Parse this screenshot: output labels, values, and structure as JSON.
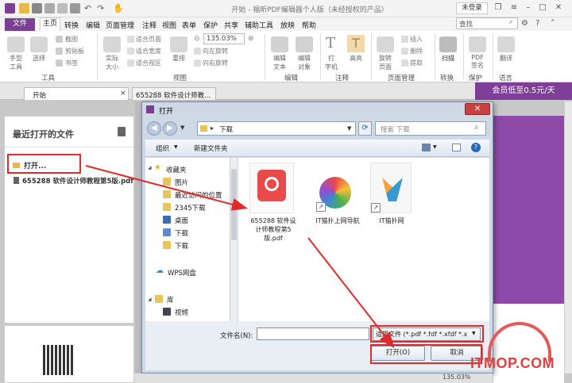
{
  "titlebar": {
    "title": "开始 - 福昕PDF编辑器个人版（未经授权的产品）",
    "login": "未登录"
  },
  "menubar": {
    "file": "文件",
    "items": [
      "主页",
      "转换",
      "编辑",
      "页面管理",
      "注释",
      "视图",
      "表单",
      "保护",
      "共享",
      "辅助工具",
      "放映",
      "帮助"
    ],
    "search_placeholder": "查找"
  },
  "ribbon": {
    "tools": {
      "hand": "手型\n工具",
      "select": "选择",
      "screenshot": "截图",
      "clipboard": "剪贴板",
      "bookmark": "书签",
      "group": "工具"
    },
    "view": {
      "actual": "实际\n大小",
      "fit_page": "适合页面",
      "fit_width": "适合宽度",
      "fit_view": "适合视区",
      "reflow": "重排",
      "zoom": "135.03%",
      "rotate_left": "向左旋转",
      "rotate_right": "向右旋转",
      "group": "视图"
    },
    "edit": {
      "edit_text": "编辑\n文本",
      "edit_object": "编辑\n对象",
      "group": "编辑"
    },
    "comment": {
      "typewriter": "打\n字机",
      "highlight": "高亮",
      "group": "注释"
    },
    "page": {
      "rotate": "旋转\n页面",
      "insert": "插入",
      "delete": "删除",
      "extract": "提取",
      "group": "页面管理"
    },
    "convert": {
      "scan": "扫描",
      "group": "转换"
    },
    "protect": {
      "sign": "PDF\n签名",
      "group": "保护"
    },
    "lang": {
      "translate": "翻译",
      "group": "语言"
    }
  },
  "tabs": {
    "start": "开始",
    "doc": "655288 软件设计师教...",
    "promo": "会员低至0.5元/天"
  },
  "leftpanel": {
    "title": "最近打开的文件",
    "open": "打开...",
    "recent_file": "655288 软件设计师教程第5版.pdf"
  },
  "dialog": {
    "title": "打开",
    "path": "下载",
    "search_placeholder": "搜索 下载",
    "organize": "组织",
    "new_folder": "新建文件夹",
    "nav": {
      "favorites": "收藏夹",
      "pictures": "图片",
      "recent": "最近访问的位置",
      "download2345": "2345下载",
      "desktop": "桌面",
      "downloads1": "下载",
      "downloads2": "下载",
      "wps": "WPS网盘",
      "library": "库",
      "video": "视频"
    },
    "files": [
      {
        "name": "655288 软件设计师教程第5版.pdf"
      },
      {
        "name": "IT猫扑上网导航"
      },
      {
        "name": "IT猫扑网"
      }
    ],
    "filename_label": "文件名(N):",
    "filename_value": "",
    "filetype": "适用文件 (*.pdf *.fdf *.xfdf *.x",
    "open_btn": "打开(O)",
    "cancel_btn": "取消"
  },
  "statusbar": {
    "zoom": "135.03%"
  },
  "watermark": {
    "text": "ITMOP.COM"
  }
}
